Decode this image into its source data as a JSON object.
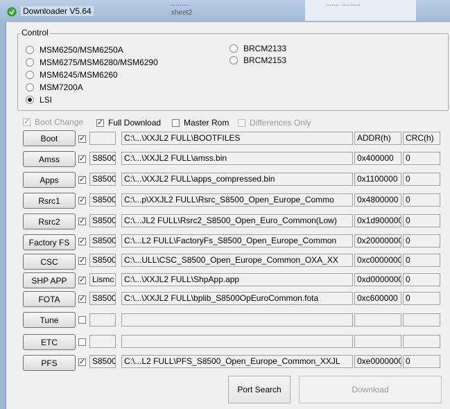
{
  "window": {
    "title": "Downloader V5.64",
    "bg_text1": "..........",
    "bg_text2": "sheet2",
    "bg_text3": ".......  .........."
  },
  "control": {
    "legend": "Control",
    "radios_left": [
      {
        "label": "MSM6250/MSM6250A",
        "checked": false
      },
      {
        "label": "MSM6275/MSM6280/MSM6290",
        "checked": false
      },
      {
        "label": "MSM6245/MSM6260",
        "checked": false
      },
      {
        "label": "MSM7200A",
        "checked": false
      },
      {
        "label": "LSI",
        "checked": true
      }
    ],
    "radios_right": [
      {
        "label": "BRCM2133",
        "checked": false
      },
      {
        "label": "BRCM2153",
        "checked": false
      }
    ]
  },
  "options": {
    "boot_change": {
      "label": "Boot Change",
      "checked": true,
      "enabled": false
    },
    "full_download": {
      "label": "Full Download",
      "checked": true,
      "enabled": true
    },
    "master_rom": {
      "label": "Master Rom",
      "checked": false,
      "enabled": true
    },
    "differences_only": {
      "label": "Differences Only",
      "checked": false,
      "enabled": false
    }
  },
  "headers": {
    "addr": "ADDR(h)",
    "crc": "CRC(h)"
  },
  "rows": [
    {
      "button": "Boot",
      "checked": true,
      "model": "",
      "path": "C:\\...\\XXJL2 FULL\\BOOTFILES",
      "addr": "ADDR(h)",
      "crc": "CRC(h)"
    },
    {
      "button": "Amss",
      "checked": true,
      "model": "S8500",
      "path": "C:\\...\\XXJL2 FULL\\amss.bin",
      "addr": "0x400000",
      "crc": "0"
    },
    {
      "button": "Apps",
      "checked": true,
      "model": "S8500",
      "path": "C:\\...\\XXJL2 FULL\\apps_compressed.bin",
      "addr": "0x1100000",
      "crc": "0"
    },
    {
      "button": "Rsrc1",
      "checked": true,
      "model": "S8500",
      "path": "C:\\...p\\XXJL2 FULL\\Rsrc_S8500_Open_Europe_Commo",
      "addr": "0x4800000",
      "crc": "0"
    },
    {
      "button": "Rsrc2",
      "checked": true,
      "model": "S8500",
      "path": "C:\\...JL2 FULL\\Rsrc2_S8500_Open_Euro_Common(Low)",
      "addr": "0x1d900000",
      "crc": "0"
    },
    {
      "button": "Factory FS",
      "checked": true,
      "model": "S8500",
      "path": "C:\\...L2 FULL\\FactoryFs_S8500_Open_Europe_Common",
      "addr": "0x20000000",
      "crc": "0"
    },
    {
      "button": "CSC",
      "checked": true,
      "model": "S8500",
      "path": "C:\\...ULL\\CSC_S8500_Open_Europe_Common_OXA_XX",
      "addr": "0xc0000000",
      "crc": "0"
    },
    {
      "button": "SHP APP",
      "checked": true,
      "model": "Lismc",
      "path": "C:\\...\\XXJL2 FULL\\ShpApp.app",
      "addr": "0xd0000000",
      "crc": "0"
    },
    {
      "button": "FOTA",
      "checked": true,
      "model": "S8500",
      "path": "C:\\...\\XXJL2 FULL\\bplib_S8500OpEuroCommon.fota",
      "addr": "0xc600000",
      "crc": "0"
    },
    {
      "button": "Tune",
      "checked": false,
      "model": "",
      "path": "",
      "addr": "",
      "crc": ""
    },
    {
      "button": "ETC",
      "checked": false,
      "model": "",
      "path": "",
      "addr": "",
      "crc": ""
    },
    {
      "button": "PFS",
      "checked": true,
      "model": "S8500",
      "path": "C:\\...L2 FULL\\PFS_S8500_Open_Europe_Common_XXJL",
      "addr": "0xe0000000",
      "crc": "0"
    }
  ],
  "footer": {
    "port_search": "Port Search",
    "download": "Download"
  }
}
